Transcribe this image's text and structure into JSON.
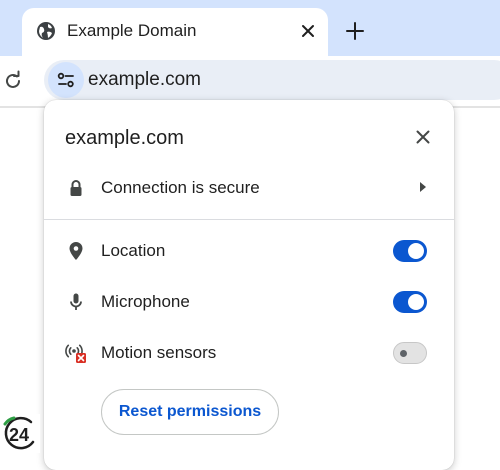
{
  "tab": {
    "title": "Example Domain",
    "favicon": "globe-icon",
    "close_icon": "close-icon"
  },
  "new_tab_icon": "plus-icon",
  "toolbar": {
    "reload_icon": "reload-icon",
    "site_info_icon": "tune-icon",
    "url": "example.com"
  },
  "popup": {
    "title": "example.com",
    "close_icon": "close-icon",
    "connection": {
      "icon": "lock-icon",
      "label": "Connection is secure",
      "chevron_icon": "chevron-right-icon"
    },
    "permissions": [
      {
        "icon": "location-pin-icon",
        "label": "Location",
        "enabled": true
      },
      {
        "icon": "microphone-icon",
        "label": "Microphone",
        "enabled": true
      },
      {
        "icon": "motion-sensors-blocked-icon",
        "label": "Motion sensors",
        "enabled": false
      }
    ],
    "reset_label": "Reset permissions"
  },
  "watermark": {
    "text": "24"
  },
  "colors": {
    "tabstrip_bg": "#d3e3fd",
    "omnibox_bg": "#e9eef6",
    "accent": "#0b57d0",
    "blocked_red": "#d93025"
  }
}
